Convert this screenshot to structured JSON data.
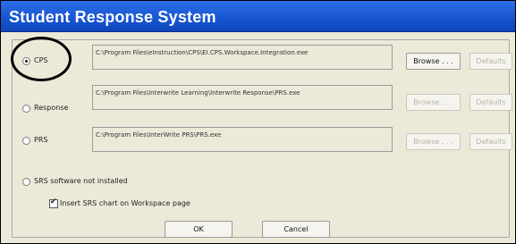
{
  "window": {
    "title": "Student Response System"
  },
  "options": [
    {
      "id": "cps",
      "label": "CPS",
      "checked": true,
      "path": "C:\\Program Files\\eInstruction\\CPS\\EI.CPS.Workspace.Integration.exe",
      "browse_label": "Browse . . .",
      "browse_enabled": true,
      "defaults_label": "Defaults",
      "defaults_enabled": false
    },
    {
      "id": "response",
      "label": "Response",
      "checked": false,
      "path": "C:\\Program Files\\Interwrite Learning\\Interwrite Response\\PRS.exe",
      "browse_label": "Browse . . .",
      "browse_enabled": false,
      "defaults_label": "Defaults",
      "defaults_enabled": false
    },
    {
      "id": "prs",
      "label": "PRS",
      "checked": false,
      "path": "C:\\Program Files\\InterWrite PRS\\PRS.exe",
      "browse_label": "Browse . . .",
      "browse_enabled": false,
      "defaults_label": "Defaults",
      "defaults_enabled": false
    },
    {
      "id": "not-installed",
      "label": "SRS software not installed",
      "checked": false
    }
  ],
  "insert_chart_checkbox": {
    "label": "Insert SRS chart on Workspace page",
    "checked": true
  },
  "buttons": {
    "ok_label": "OK",
    "cancel_label": "Cancel"
  },
  "colors": {
    "titlebar": "#1a58d4",
    "dialog_bg": "#ece9d8",
    "disabled_text": "#b8b5a8"
  }
}
